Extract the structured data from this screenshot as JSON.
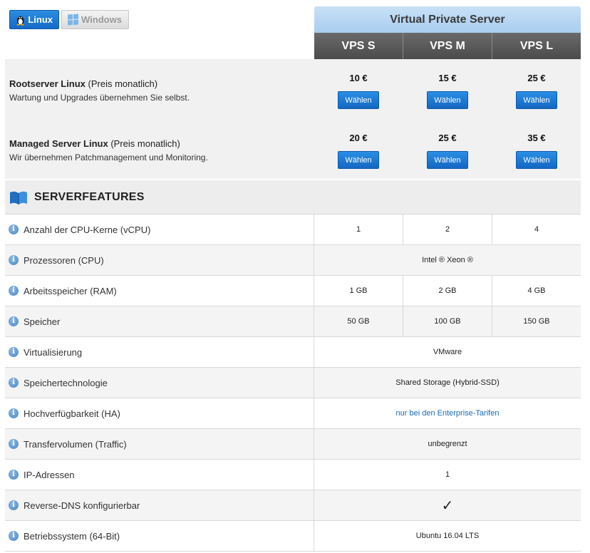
{
  "os_tabs": [
    {
      "label": "Linux",
      "active": true,
      "icon": "tux-icon"
    },
    {
      "label": "Windows",
      "active": false,
      "icon": "windows-icon"
    }
  ],
  "plan_header": {
    "title": "Virtual Private Server",
    "plans": [
      "VPS S",
      "VPS M",
      "VPS L"
    ]
  },
  "pricing": [
    {
      "title_bold": "Rootserver Linux",
      "title_rest": " (Preis monatlich)",
      "subtitle": "Wartung und Upgrades übernehmen Sie selbst.",
      "prices": [
        "10 €",
        "15 €",
        "25 €"
      ],
      "button_label": "Wählen"
    },
    {
      "title_bold": "Managed Server Linux",
      "title_rest": " (Preis monatlich)",
      "subtitle": "Wir übernehmen Patchmanagement und Monitoring.",
      "prices": [
        "20 €",
        "25 €",
        "35 €"
      ],
      "button_label": "Wählen"
    }
  ],
  "features_title": "SERVERFEATURES",
  "features": [
    {
      "name": "Anzahl der CPU-Kerne (vCPU)",
      "values": [
        "1",
        "2",
        "4"
      ]
    },
    {
      "name": "Prozessoren (CPU)",
      "value": "Intel ® Xeon ®"
    },
    {
      "name": "Arbeitsspeicher (RAM)",
      "values": [
        "1 GB",
        "2 GB",
        "4 GB"
      ]
    },
    {
      "name": "Speicher",
      "values": [
        "50 GB",
        "100 GB",
        "150 GB"
      ]
    },
    {
      "name": "Virtualisierung",
      "value": "VMware"
    },
    {
      "name": "Speichertechnologie",
      "value": "Shared Storage (Hybrid-SSD)"
    },
    {
      "name": "Hochverfügbarkeit (HA)",
      "value": "nur bei den Enterprise-Tarifen",
      "link": true
    },
    {
      "name": "Transfervolumen (Traffic)",
      "value": "unbegrenzt"
    },
    {
      "name": "IP-Adressen",
      "value": "1"
    },
    {
      "name": "Reverse-DNS konfigurierbar",
      "value": "✓",
      "check": true
    },
    {
      "name": "Betriebssystem (64-Bit)",
      "value": "Ubuntu 16.04 LTS"
    }
  ],
  "colors": {
    "accent": "#1a73cf",
    "header_dark": "#555555",
    "header_light": "#b8d7f3"
  }
}
